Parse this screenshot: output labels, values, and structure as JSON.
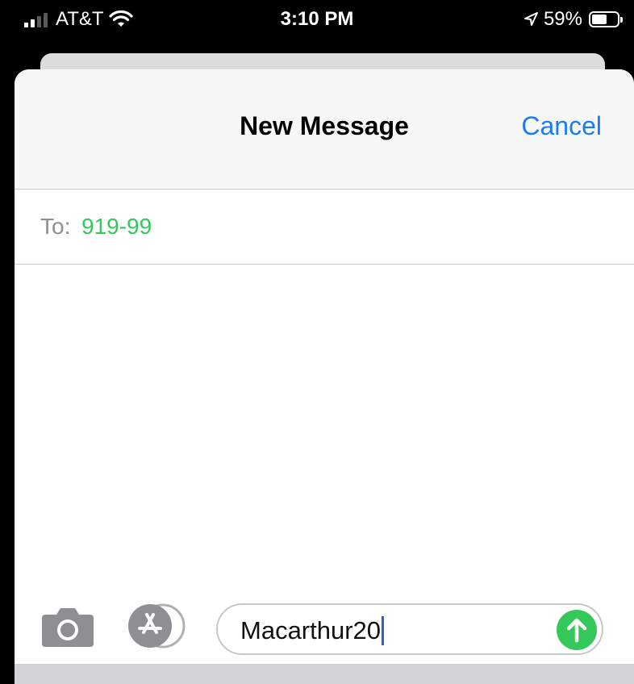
{
  "status_bar": {
    "carrier": "AT&T",
    "time": "3:10 PM",
    "battery_percent": "59%",
    "battery_level": 0.59,
    "icons": [
      "cellular-signal-icon",
      "wifi-icon",
      "location-arrow-icon",
      "battery-icon"
    ]
  },
  "compose": {
    "title": "New Message",
    "cancel_label": "Cancel",
    "to_label": "To:",
    "recipient": "919-99"
  },
  "input_bar": {
    "message_text": "Macarthur20",
    "icons": [
      "camera-icon",
      "app-store-icon",
      "send-arrow-icon"
    ]
  },
  "colors": {
    "accent_blue": "#1a7cf6",
    "recipient_green": "#34c759",
    "send_green": "#34c759",
    "caret_blue": "#2f5bd8"
  }
}
